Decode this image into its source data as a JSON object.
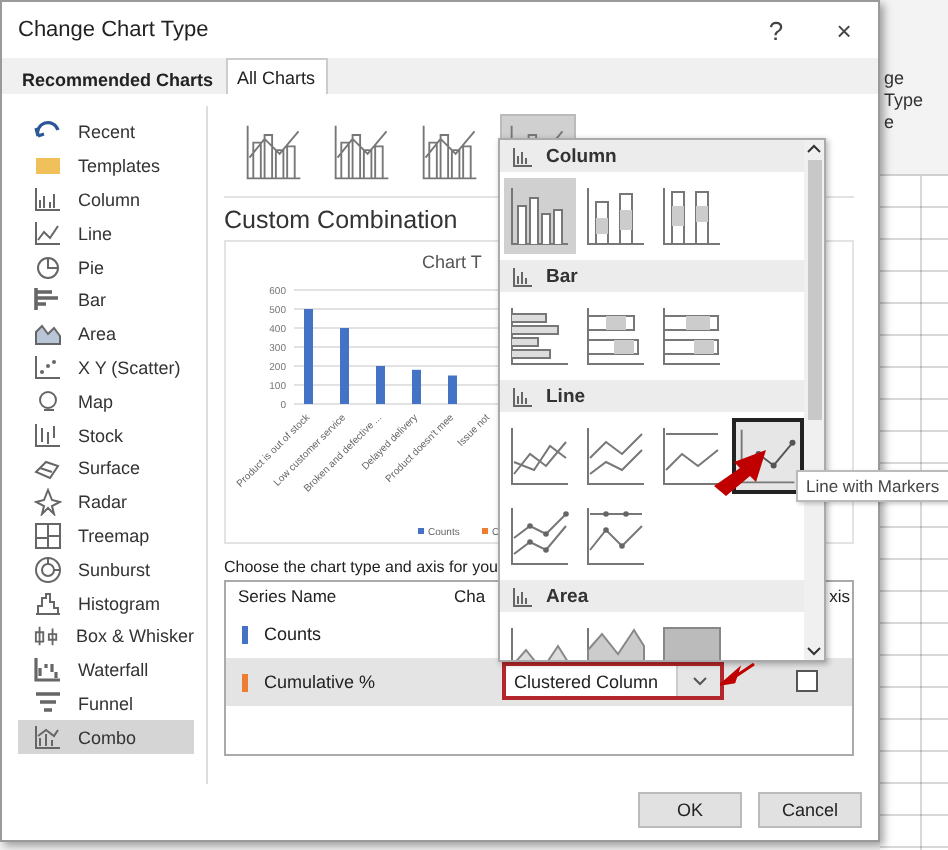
{
  "window": {
    "title": "Change Chart Type",
    "help": "?",
    "close": "×"
  },
  "tabs": [
    {
      "label": "Recommended Charts",
      "selected": false
    },
    {
      "label": "All Charts",
      "selected": true
    }
  ],
  "sidebar": {
    "items": [
      {
        "label": "Recent",
        "selected": false
      },
      {
        "label": "Templates",
        "selected": false
      },
      {
        "label": "Column",
        "selected": false
      },
      {
        "label": "Line",
        "selected": false
      },
      {
        "label": "Pie",
        "selected": false
      },
      {
        "label": "Bar",
        "selected": false
      },
      {
        "label": "Area",
        "selected": false
      },
      {
        "label": "X Y (Scatter)",
        "selected": false
      },
      {
        "label": "Map",
        "selected": false
      },
      {
        "label": "Stock",
        "selected": false
      },
      {
        "label": "Surface",
        "selected": false
      },
      {
        "label": "Radar",
        "selected": false
      },
      {
        "label": "Treemap",
        "selected": false
      },
      {
        "label": "Sunburst",
        "selected": false
      },
      {
        "label": "Histogram",
        "selected": false
      },
      {
        "label": "Box & Whisker",
        "selected": false
      },
      {
        "label": "Waterfall",
        "selected": false
      },
      {
        "label": "Funnel",
        "selected": false
      },
      {
        "label": "Combo",
        "selected": true
      }
    ]
  },
  "subtypes": [
    {
      "selected": false
    },
    {
      "selected": false
    },
    {
      "selected": false
    },
    {
      "selected": true
    }
  ],
  "heading": "Custom Combination",
  "chart": {
    "chart_data": {
      "type": "bar",
      "title": "Chart T",
      "categories": [
        "Product is out of stock",
        "Low customer service",
        "Broken and defective ...",
        "Delayed delivery",
        "Product doesn't mee",
        "Issue not"
      ],
      "series": [
        {
          "name": "Counts",
          "color": "#4472c4",
          "values": [
            500,
            400,
            200,
            180,
            150,
            null
          ]
        }
      ],
      "ylim": [
        0,
        600
      ],
      "yticks": [
        0,
        100,
        200,
        300,
        400,
        500,
        600
      ],
      "grid": true
    },
    "legend_extra": [
      {
        "name": "C",
        "color": "#ed7d31"
      }
    ]
  },
  "instruction": "Choose the chart type and axis for you",
  "table": {
    "columns": [
      "Series Name",
      "Cha",
      "xis"
    ],
    "rows": [
      {
        "name": "Counts",
        "color": "#4472c4",
        "selected": false
      },
      {
        "name": "Cumulative %",
        "color": "#ed7d31",
        "selected": true,
        "chart_type": "Clustered Column",
        "secondary_axis": false
      }
    ]
  },
  "popup": {
    "sections": [
      {
        "label": "Column",
        "tiles": [
          {
            "kind": "clustered-column",
            "selected": true,
            "hovered": false
          },
          {
            "kind": "stacked-column",
            "selected": false,
            "hovered": false
          },
          {
            "kind": "stacked-100-column",
            "selected": false,
            "hovered": false
          }
        ]
      },
      {
        "label": "Bar",
        "tiles": [
          {
            "kind": "clustered-bar",
            "selected": false,
            "hovered": false
          },
          {
            "kind": "stacked-bar",
            "selected": false,
            "hovered": false
          },
          {
            "kind": "stacked-100-bar",
            "selected": false,
            "hovered": false
          }
        ]
      },
      {
        "label": "Line",
        "tiles": [
          {
            "kind": "line",
            "selected": false,
            "hovered": false
          },
          {
            "kind": "stacked-line",
            "selected": false,
            "hovered": false
          },
          {
            "kind": "stacked-100-line",
            "selected": false,
            "hovered": false
          },
          {
            "kind": "line-markers",
            "selected": false,
            "hovered": true
          },
          {
            "kind": "stacked-line-markers",
            "selected": false,
            "hovered": false
          },
          {
            "kind": "stacked-100-line-markers",
            "selected": false,
            "hovered": false
          }
        ]
      },
      {
        "label": "Area",
        "tiles": [
          {
            "kind": "area",
            "selected": false,
            "hovered": false
          },
          {
            "kind": "stacked-area",
            "selected": false,
            "hovered": false
          },
          {
            "kind": "stacked-100-area",
            "selected": false,
            "hovered": false
          }
        ]
      }
    ]
  },
  "tooltip": "Line with Markers",
  "buttons": [
    "OK",
    "Cancel"
  ],
  "background_ribbon": [
    "ge",
    "Type",
    "e"
  ]
}
